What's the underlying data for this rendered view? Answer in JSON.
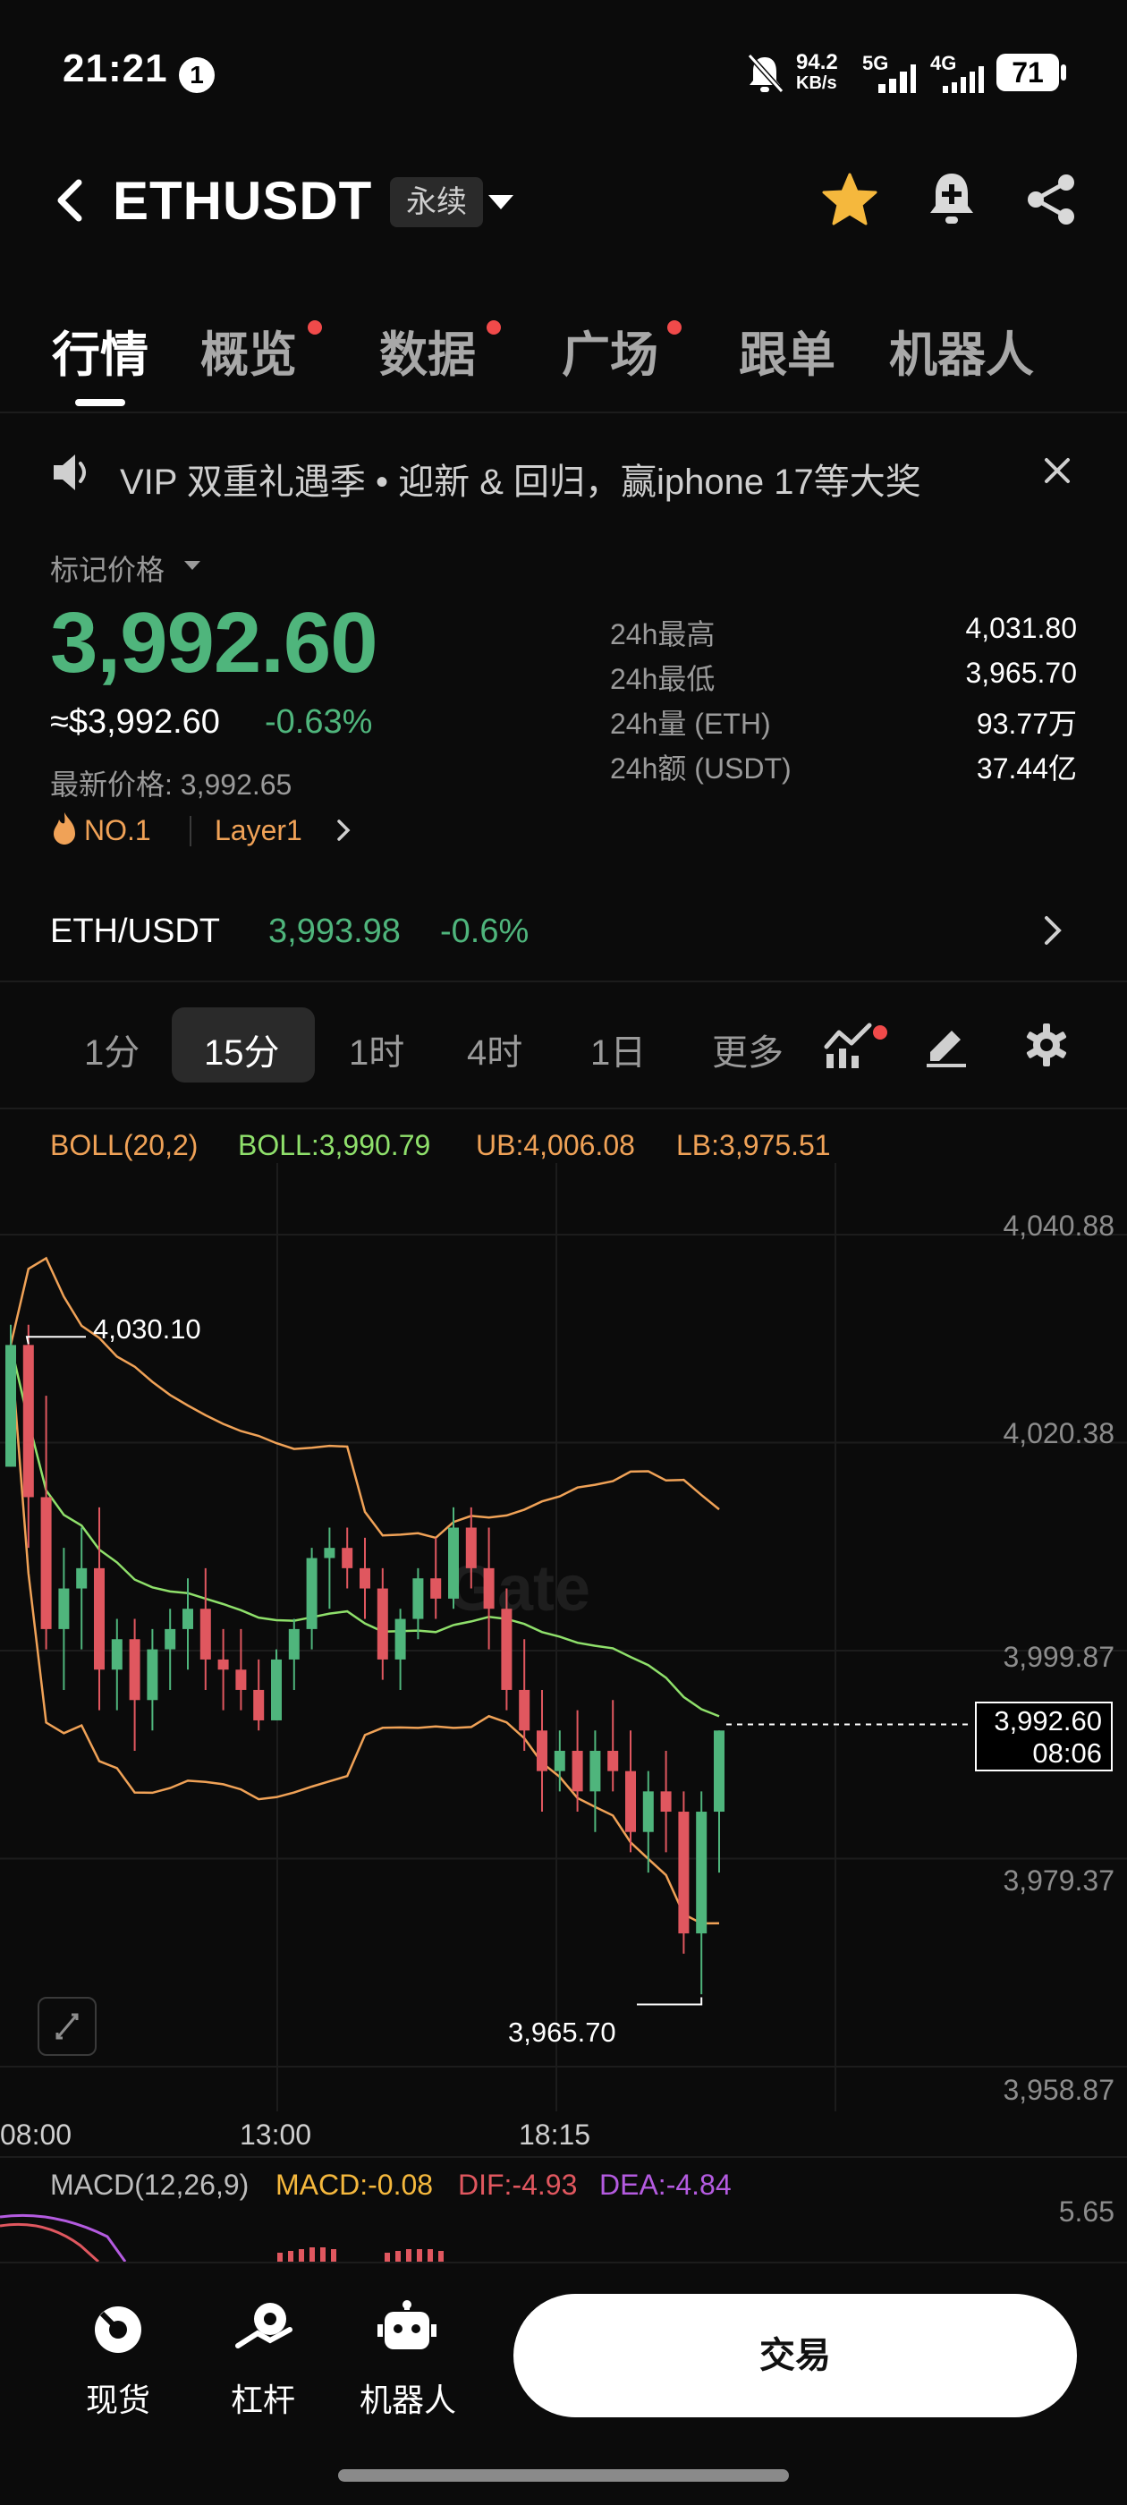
{
  "status_bar": {
    "time": "21:21",
    "notification_count": "1",
    "net_speed_value": "94.2",
    "net_speed_unit": "KB/s",
    "signal_1": "5G",
    "signal_2": "4G",
    "battery": "71"
  },
  "header": {
    "title": "ETHUSDT",
    "contract_type": "永续"
  },
  "tabs": [
    {
      "label": "行情",
      "active": true,
      "dot": false
    },
    {
      "label": "概览",
      "active": false,
      "dot": true
    },
    {
      "label": "数据",
      "active": false,
      "dot": true
    },
    {
      "label": "广场",
      "active": false,
      "dot": true
    },
    {
      "label": "跟单",
      "active": false,
      "dot": false
    },
    {
      "label": "机器人",
      "active": false,
      "dot": false
    }
  ],
  "banner": {
    "text": "VIP 双重礼遇季 • 迎新 & 回归，赢iphone 17等大奖"
  },
  "price": {
    "mark_label": "标记价格",
    "mark_price": "3,992.60",
    "usd_price": "≈$3,992.60",
    "change_pct": "-0.63%",
    "last_price": "最新价格: 3,992.65",
    "rank_tag": "NO.1",
    "category_tag": "Layer1"
  },
  "stats": [
    {
      "label": "24h最高",
      "value": "4,031.80"
    },
    {
      "label": "24h最低",
      "value": "3,965.70"
    },
    {
      "label": "24h量 (ETH)",
      "value": "93.77万"
    },
    {
      "label": "24h额 (USDT)",
      "value": "37.44亿"
    }
  ],
  "pair": {
    "name": "ETH/USDT",
    "price": "3,993.98",
    "change": "-0.6%"
  },
  "intervals": [
    {
      "label": "1分",
      "active": false
    },
    {
      "label": "15分",
      "active": true
    },
    {
      "label": "1时",
      "active": false
    },
    {
      "label": "4时",
      "active": false
    },
    {
      "label": "1日",
      "active": false
    },
    {
      "label": "更多",
      "active": false
    }
  ],
  "indicators": {
    "boll_name": "BOLL(20,2)",
    "boll_mid": "BOLL:3,990.79",
    "boll_ub": "UB:4,006.08",
    "boll_lb": "LB:3,975.51"
  },
  "chart_data": {
    "type": "candlestick",
    "y_ticks": [
      "4,040.88",
      "4,020.38",
      "3,999.87",
      "3,979.37",
      "3,958.87"
    ],
    "x_ticks": [
      "08:00",
      "13:00",
      "18:15"
    ],
    "ylim": [
      3958.87,
      4040.88
    ],
    "high_annotation": "4,030.10",
    "low_annotation": "3,965.70",
    "current_price": "3,992.60",
    "countdown": "08:06",
    "watermark": "Gate",
    "colors": {
      "up": "#4fb57c",
      "down": "#e0575f",
      "boll_band": "#f0a257",
      "boll_mid": "#8fe06b"
    },
    "candles": [
      [
        4018,
        4032,
        4018,
        4030
      ],
      [
        4030,
        4032,
        4010,
        4015
      ],
      [
        4015,
        4025,
        4000,
        4002
      ],
      [
        4002,
        4010,
        3996,
        4006
      ],
      [
        4006,
        4012,
        4000,
        4008
      ],
      [
        4008,
        4014,
        3994,
        3998
      ],
      [
        3998,
        4003,
        3994,
        4001
      ],
      [
        4001,
        4003,
        3990,
        3995
      ],
      [
        3995,
        4002,
        3992,
        4000
      ],
      [
        4000,
        4004,
        3996,
        4002
      ],
      [
        4002,
        4007,
        3998,
        4004
      ],
      [
        4004,
        4008,
        3996,
        3999
      ],
      [
        3999,
        4002,
        3994,
        3998
      ],
      [
        3998,
        4002,
        3994,
        3996
      ],
      [
        3996,
        3999,
        3992,
        3993
      ],
      [
        3993,
        4000,
        3993,
        3999
      ],
      [
        3999,
        4003,
        3996,
        4002
      ],
      [
        4002,
        4010,
        4000,
        4009
      ],
      [
        4009,
        4012,
        4004,
        4010
      ],
      [
        4010,
        4012,
        4006,
        4008
      ],
      [
        4008,
        4011,
        4003,
        4006
      ],
      [
        4006,
        4008,
        3997,
        3999
      ],
      [
        3999,
        4004,
        3996,
        4003
      ],
      [
        4003,
        4008,
        4001,
        4007
      ],
      [
        4007,
        4011,
        4003,
        4005
      ],
      [
        4005,
        4014,
        4004,
        4012
      ],
      [
        4012,
        4014,
        4006,
        4008
      ],
      [
        4008,
        4012,
        4000,
        4004
      ],
      [
        4004,
        4006,
        3994,
        3996
      ],
      [
        3996,
        4001,
        3990,
        3992
      ],
      [
        3992,
        3996,
        3984,
        3988
      ],
      [
        3988,
        3992,
        3986,
        3990
      ],
      [
        3990,
        3994,
        3984,
        3986
      ],
      [
        3986,
        3992,
        3982,
        3990
      ],
      [
        3990,
        3995,
        3986,
        3988
      ],
      [
        3988,
        3992,
        3980,
        3982
      ],
      [
        3982,
        3988,
        3978,
        3986
      ],
      [
        3986,
        3990,
        3980,
        3984
      ],
      [
        3984,
        3986,
        3970,
        3972
      ],
      [
        3972,
        3986,
        3966,
        3984
      ],
      [
        3984,
        3992,
        3978,
        3992
      ]
    ]
  },
  "macd": {
    "label": "MACD(12,26,9)",
    "macd": "MACD:-0.08",
    "dif": "DIF:-4.93",
    "dea": "DEA:-4.84",
    "scale_top": "5.65"
  },
  "bottom_nav": [
    {
      "label": "现货",
      "icon": "spot-icon"
    },
    {
      "label": "杠杆",
      "icon": "margin-icon"
    },
    {
      "label": "机器人",
      "icon": "robot-icon"
    }
  ],
  "trade_button": "交易"
}
